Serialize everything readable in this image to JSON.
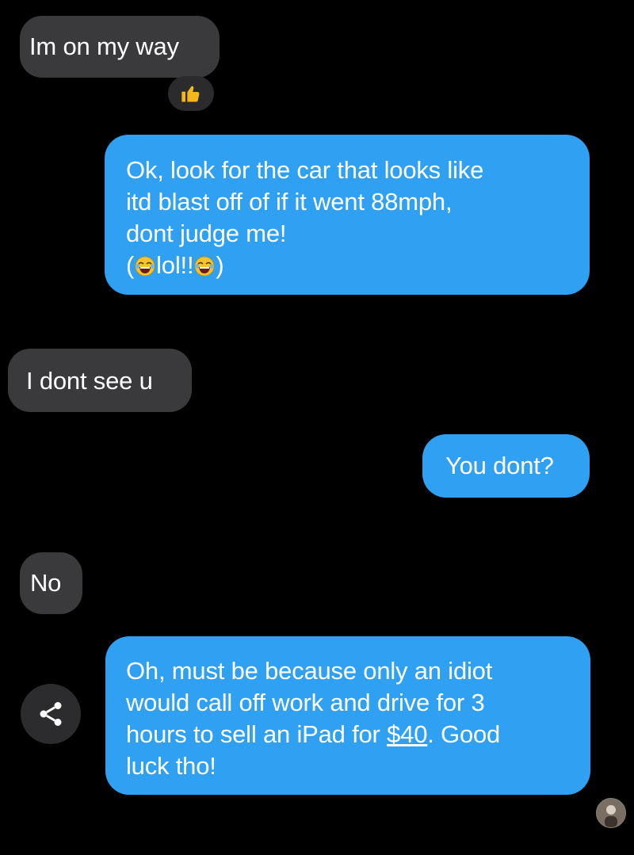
{
  "conversation": {
    "messages": [
      {
        "direction": "incoming",
        "lines": [
          "Im on my way"
        ],
        "reaction": "thumbs-up"
      },
      {
        "direction": "outgoing",
        "lines": [
          "Ok, look for the car that looks like",
          "itd blast off of if it went 88mph,",
          "dont judge me!"
        ],
        "emoji_line": {
          "open": "(",
          "text": "lol!!",
          "close": ")",
          "emoji": "face-with-tears-of-joy"
        }
      },
      {
        "direction": "incoming",
        "lines": [
          "I dont see u"
        ]
      },
      {
        "direction": "outgoing",
        "lines": [
          "You dont?"
        ]
      },
      {
        "direction": "incoming",
        "lines": [
          "No"
        ]
      },
      {
        "direction": "outgoing",
        "lines": [
          "Oh, must be because only an idiot",
          "would call off work and drive for 3",
          "hours to sell an iPad for ",
          "$40",
          ". Good",
          "luck tho!"
        ]
      }
    ]
  },
  "icons": {
    "reaction": "thumbs-up-icon",
    "share": "share-icon",
    "avatar": "contact-avatar"
  },
  "colors": {
    "background": "#000000",
    "incoming_bubble": "#3a3a3c",
    "outgoing_bubble": "#2fa0f2",
    "text": "#ffffff"
  }
}
